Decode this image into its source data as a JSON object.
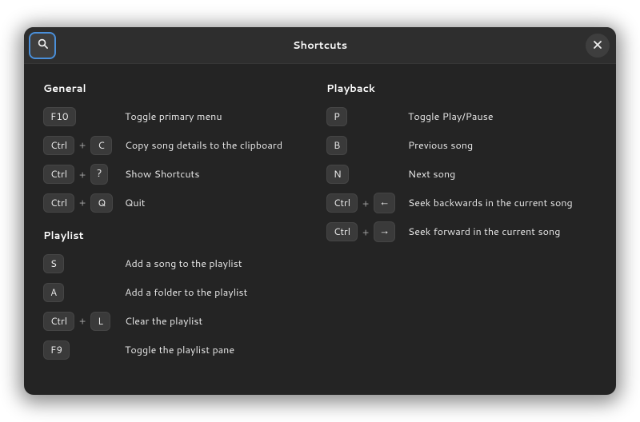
{
  "window": {
    "title": "Shortcuts"
  },
  "icons": {
    "search": "search-icon",
    "close": "close-icon"
  },
  "columns": [
    {
      "sections": [
        {
          "title": "General",
          "rows": [
            {
              "keys": [
                "F10"
              ],
              "desc": "Toggle primary menu"
            },
            {
              "keys": [
                "Ctrl",
                "C"
              ],
              "desc": "Copy song details to the clipboard"
            },
            {
              "keys": [
                "Ctrl",
                "?"
              ],
              "desc": "Show Shortcuts"
            },
            {
              "keys": [
                "Ctrl",
                "Q"
              ],
              "desc": "Quit"
            }
          ]
        },
        {
          "title": "Playlist",
          "rows": [
            {
              "keys": [
                "S"
              ],
              "desc": "Add a song to the playlist"
            },
            {
              "keys": [
                "A"
              ],
              "desc": "Add a folder to the playlist"
            },
            {
              "keys": [
                "Ctrl",
                "L"
              ],
              "desc": "Clear the playlist"
            },
            {
              "keys": [
                "F9"
              ],
              "desc": "Toggle the playlist pane"
            }
          ]
        }
      ]
    },
    {
      "sections": [
        {
          "title": "Playback",
          "rows": [
            {
              "keys": [
                "P"
              ],
              "desc": "Toggle Play/Pause"
            },
            {
              "keys": [
                "B"
              ],
              "desc": "Previous song"
            },
            {
              "keys": [
                "N"
              ],
              "desc": "Next song"
            },
            {
              "keys": [
                "Ctrl",
                "←"
              ],
              "desc": "Seek backwards in the current song"
            },
            {
              "keys": [
                "Ctrl",
                "→"
              ],
              "desc": "Seek forward in the current song"
            }
          ]
        }
      ]
    }
  ]
}
